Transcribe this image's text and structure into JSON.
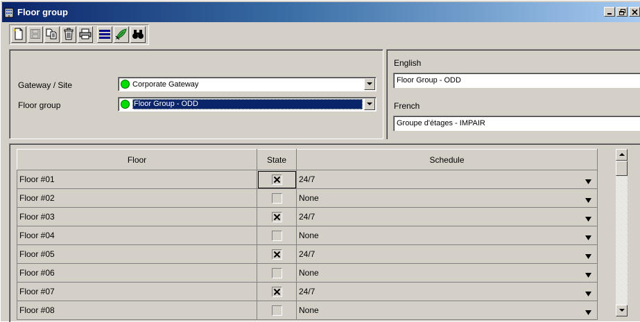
{
  "window": {
    "title": "Floor group",
    "title_icon": "building-icon",
    "controls": [
      "minimize",
      "restore",
      "close"
    ]
  },
  "toolbar": {
    "buttons": [
      {
        "name": "new-button",
        "icon": "new-document-icon"
      },
      {
        "name": "save-button",
        "icon": "floppy-disk-icon",
        "disabled": true
      },
      {
        "name": "copy-button",
        "icon": "copy-icon"
      },
      {
        "name": "delete-button",
        "icon": "trash-icon"
      },
      {
        "name": "print-button",
        "icon": "printer-icon"
      },
      {
        "name": "list-button",
        "icon": "list-icon"
      },
      {
        "name": "link-button",
        "icon": "leaf-link-icon"
      },
      {
        "name": "find-button",
        "icon": "binoculars-icon"
      }
    ]
  },
  "form": {
    "gateway_label": "Gateway / Site",
    "gateway_value": "Corporate Gateway",
    "floor_group_label": "Floor group",
    "floor_group_value": "Floor Group - ODD"
  },
  "names": {
    "english_label": "English",
    "english_value": "Floor Group - ODD",
    "french_label": "French",
    "french_value": "Groupe d'étages - IMPAIR"
  },
  "grid": {
    "headers": {
      "floor": "Floor",
      "state": "State",
      "schedule": "Schedule"
    },
    "rows": [
      {
        "floor": "Floor #01",
        "checked": true,
        "schedule": "24/7"
      },
      {
        "floor": "Floor #02",
        "checked": false,
        "schedule": "None"
      },
      {
        "floor": "Floor #03",
        "checked": true,
        "schedule": "24/7"
      },
      {
        "floor": "Floor #04",
        "checked": false,
        "schedule": "None"
      },
      {
        "floor": "Floor #05",
        "checked": true,
        "schedule": "24/7"
      },
      {
        "floor": "Floor #06",
        "checked": false,
        "schedule": "None"
      },
      {
        "floor": "Floor #07",
        "checked": true,
        "schedule": "24/7"
      },
      {
        "floor": "Floor #08",
        "checked": false,
        "schedule": "None"
      }
    ]
  },
  "colors": {
    "face": "#d4d0c8",
    "title_start": "#0a246a",
    "title_end": "#a6caf0",
    "status_dot": "#00dd00",
    "selection": "#0a246a"
  }
}
